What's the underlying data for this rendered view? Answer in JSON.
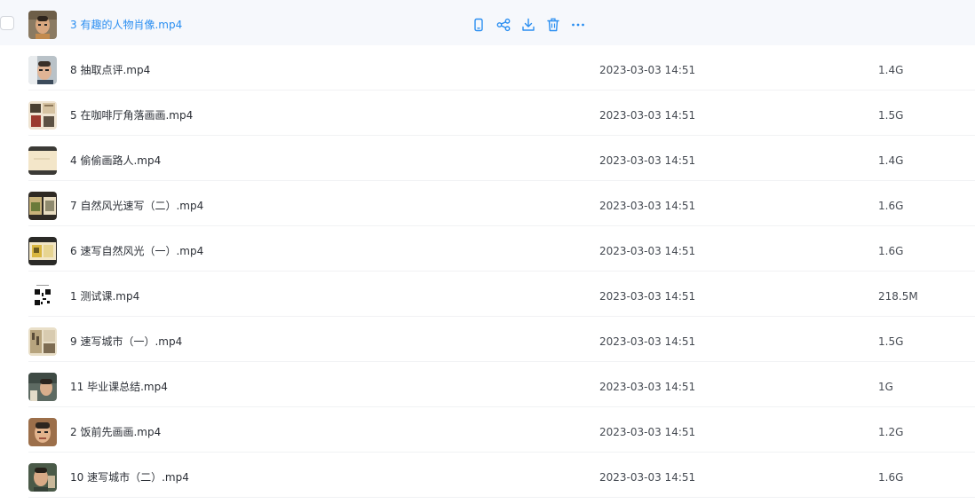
{
  "colors": {
    "accent": "#2a8ef1",
    "hover_row_bg": "#f6f8fc",
    "text": "#2b2f36",
    "meta_text": "#454a52"
  },
  "hover_actions": [
    {
      "name": "phone-icon"
    },
    {
      "name": "share-icon"
    },
    {
      "name": "download-icon"
    },
    {
      "name": "delete-icon"
    },
    {
      "name": "more-icon"
    }
  ],
  "files": [
    {
      "name": "3 有趣的人物肖像.mp4",
      "date": "",
      "size": "",
      "thumb": "portrait-a",
      "hovered": true
    },
    {
      "name": "8 抽取点评.mp4",
      "date": "2023-03-03 14:51",
      "size": "1.4G",
      "thumb": "portrait-b"
    },
    {
      "name": "5 在咖啡厅角落画画.mp4",
      "date": "2023-03-03 14:51",
      "size": "1.5G",
      "thumb": "sketch-collage"
    },
    {
      "name": "4 偷偷画路人.mp4",
      "date": "2023-03-03 14:51",
      "size": "1.4G",
      "thumb": "paper"
    },
    {
      "name": "7 自然风光速写（二）.mp4",
      "date": "2023-03-03 14:51",
      "size": "1.6G",
      "thumb": "landscape"
    },
    {
      "name": "6 速写自然风光（一）.mp4",
      "date": "2023-03-03 14:51",
      "size": "1.6G",
      "thumb": "landscape-yellow"
    },
    {
      "name": "1 测试课.mp4",
      "date": "2023-03-03 14:51",
      "size": "218.5M",
      "thumb": "qr"
    },
    {
      "name": "9 速写城市（一）.mp4",
      "date": "2023-03-03 14:51",
      "size": "1.5G",
      "thumb": "city"
    },
    {
      "name": "11 毕业课总结.mp4",
      "date": "2023-03-03 14:51",
      "size": "1G",
      "thumb": "portrait-c"
    },
    {
      "name": "2 饭前先画画.mp4",
      "date": "2023-03-03 14:51",
      "size": "1.2G",
      "thumb": "portrait-d"
    },
    {
      "name": "10 速写城市（二）.mp4",
      "date": "2023-03-03 14:51",
      "size": "1.6G",
      "thumb": "portrait-e"
    }
  ]
}
